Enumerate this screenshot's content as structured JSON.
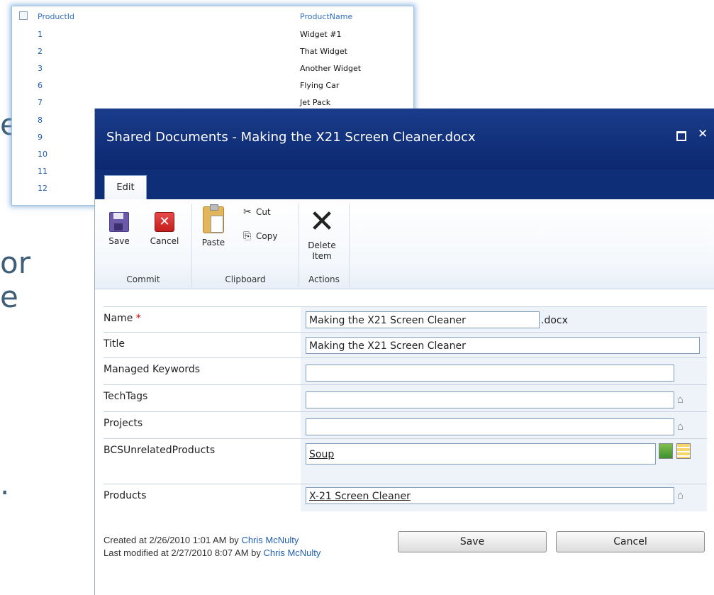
{
  "background": {
    "fragments": [
      "e",
      "or",
      "e",
      "."
    ],
    "list": {
      "headers": {
        "id": "ProductId",
        "name": "ProductName"
      },
      "rows": [
        {
          "id": "1",
          "name": "Widget #1"
        },
        {
          "id": "2",
          "name": "That Widget"
        },
        {
          "id": "3",
          "name": "Another Widget"
        },
        {
          "id": "6",
          "name": "Flying Car"
        },
        {
          "id": "7",
          "name": "Jet Pack"
        },
        {
          "id": "8",
          "name": ""
        },
        {
          "id": "9",
          "name": ""
        },
        {
          "id": "10",
          "name": ""
        },
        {
          "id": "11",
          "name": ""
        },
        {
          "id": "12",
          "name": ""
        }
      ]
    }
  },
  "dialog": {
    "title": "Shared Documents - Making the X21 Screen Cleaner.docx",
    "maximize_icon": "maximize-icon",
    "close_icon": "close-icon",
    "close_glyph": "✕",
    "tab": "Edit",
    "ribbon": {
      "commit": {
        "label": "Commit",
        "save": "Save",
        "cancel": "Cancel",
        "cancel_glyph": "✕"
      },
      "clipboard": {
        "label": "Clipboard",
        "paste": "Paste",
        "cut": "Cut",
        "copy": "Copy",
        "cut_glyph": "✂",
        "copy_glyph": "⎘"
      },
      "actions": {
        "label": "Actions",
        "delete": "Delete Item",
        "delete_glyph": "✕"
      }
    },
    "fields": {
      "name": {
        "label": "Name",
        "required_mark": "*",
        "value": "Making the X21 Screen Cleaner",
        "suffix": ".docx"
      },
      "title": {
        "label": "Title",
        "value": "Making the X21 Screen Cleaner"
      },
      "managed_keywords": {
        "label": "Managed Keywords",
        "value": ""
      },
      "techtags": {
        "label": "TechTags",
        "value": ""
      },
      "projects": {
        "label": "Projects",
        "value": ""
      },
      "bcs_unrelated": {
        "label": "BCSUnrelatedProducts",
        "value": "Soup"
      },
      "products": {
        "label": "Products",
        "value": "X-21 Screen Cleaner"
      }
    },
    "tag_glyph": "⌂",
    "meta": {
      "created_prefix": "Created at 2/26/2010 1:01 AM by",
      "created_by": "Chris McNulty",
      "modified_prefix": "Last modified at 2/27/2010 8:07 AM by",
      "modified_by": "Chris McNulty"
    },
    "buttons": {
      "save": "Save",
      "cancel": "Cancel"
    }
  }
}
